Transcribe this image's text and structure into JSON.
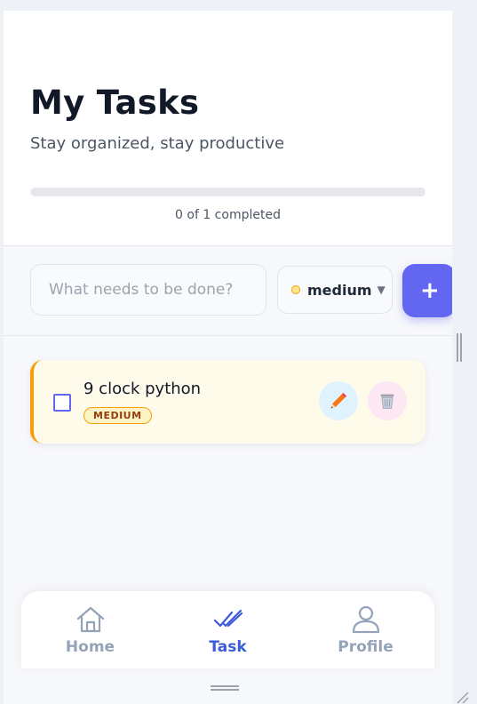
{
  "header": {
    "title": "My Tasks",
    "subtitle": "Stay organized, stay productive"
  },
  "progress": {
    "completed": 0,
    "total": 1,
    "fraction": 0,
    "text": "0 of 1 completed"
  },
  "new_task": {
    "placeholder": "What needs to be done?",
    "value": "",
    "priority": "medium",
    "add_label": "+"
  },
  "tasks": [
    {
      "title": "9 clock python",
      "priority_badge": "MEDIUM",
      "completed": false,
      "accent_color": "#f59e0b"
    }
  ],
  "nav": {
    "items": [
      {
        "label": "Home",
        "icon": "home-icon",
        "active": false
      },
      {
        "label": "Task",
        "icon": "double-check-icon",
        "active": true
      },
      {
        "label": "Profile",
        "icon": "user-icon",
        "active": false
      }
    ]
  },
  "colors": {
    "accent": "#6366f1",
    "nav_active": "#3b5bdb",
    "medium_priority": "#f59e0b"
  }
}
